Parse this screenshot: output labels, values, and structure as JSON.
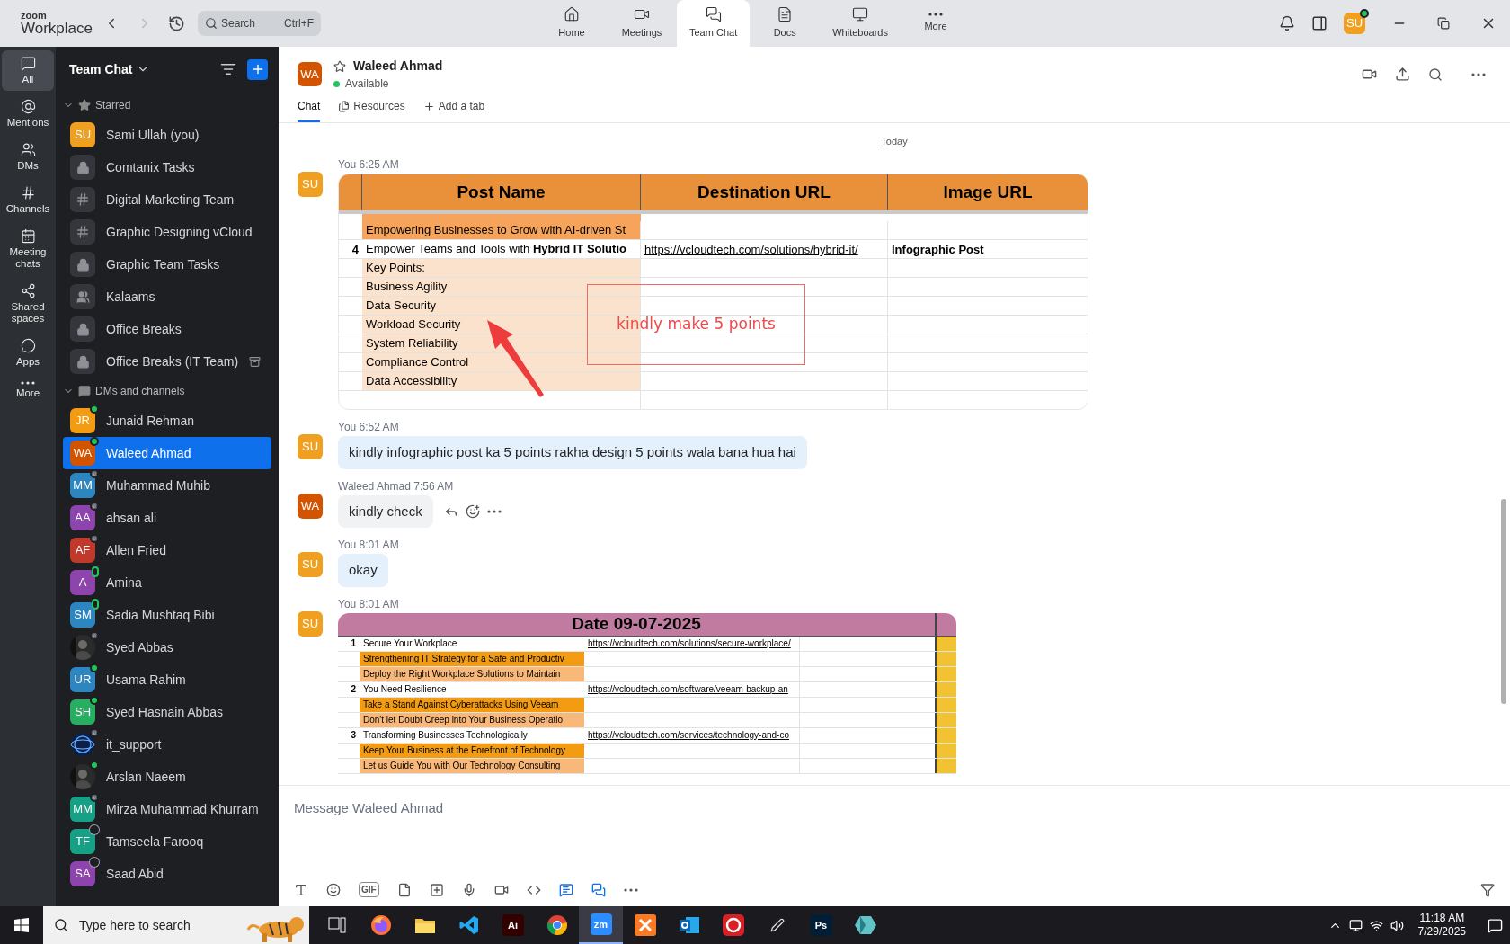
{
  "app": {
    "logo_top": "zoom",
    "logo_bottom": "Workplace"
  },
  "search": {
    "placeholder": "Search",
    "shortcut": "Ctrl+F"
  },
  "nav_tabs": [
    {
      "label": "Home",
      "selected": false
    },
    {
      "label": "Meetings",
      "selected": false
    },
    {
      "label": "Team Chat",
      "selected": true
    },
    {
      "label": "Docs",
      "selected": false
    },
    {
      "label": "Whiteboards",
      "selected": false
    },
    {
      "label": "More",
      "selected": false
    }
  ],
  "user": {
    "initials": "SU",
    "presence": {
      "kind": "online"
    }
  },
  "rail": [
    {
      "label": "All",
      "selected": true
    },
    {
      "label": "Mentions",
      "selected": false
    },
    {
      "label": "DMs",
      "selected": false
    },
    {
      "label": "Channels",
      "selected": false
    },
    {
      "label": "Meeting chats",
      "selected": false
    },
    {
      "label": "Shared spaces",
      "selected": false
    },
    {
      "label": "Apps",
      "selected": false
    },
    {
      "label": "More",
      "selected": false
    }
  ],
  "sidebar": {
    "title": "Team Chat",
    "sections": [
      {
        "title": "Starred",
        "expanded": true,
        "items": [
          {
            "name": "Sami Ullah (you)",
            "kind": "avatar",
            "initials": "SU",
            "color": "#f0a020",
            "archived": false,
            "selected": false
          },
          {
            "name": "Comtanix Tasks",
            "kind": "lock",
            "archived": false,
            "selected": false
          },
          {
            "name": "Digital Marketing Team",
            "kind": "hash",
            "archived": false,
            "selected": false
          },
          {
            "name": "Graphic Designing vCloud",
            "kind": "hash",
            "archived": false,
            "selected": false
          },
          {
            "name": "Graphic Team Tasks",
            "kind": "lock",
            "archived": false,
            "selected": false
          },
          {
            "name": "Kalaams",
            "kind": "group",
            "archived": false,
            "selected": false
          },
          {
            "name": "Office Breaks",
            "kind": "lock",
            "archived": false,
            "selected": false
          },
          {
            "name": "Office Breaks (IT Team)",
            "kind": "lock",
            "archived": true,
            "selected": false
          }
        ]
      },
      {
        "title": "DMs and channels",
        "expanded": true,
        "items": [
          {
            "name": "Junaid Rehman",
            "kind": "avatar",
            "initials": "JR",
            "color": "#f39c12",
            "presence": {
              "kind": "online"
            },
            "archived": false,
            "selected": false
          },
          {
            "name": "Waleed Ahmad",
            "kind": "avatar",
            "initials": "WA",
            "color": "#d35400",
            "presence": {
              "kind": "online"
            },
            "archived": false,
            "selected": true
          },
          {
            "name": "Muhammad Muhib",
            "kind": "avatar",
            "initials": "MM",
            "color": "#2e86c1",
            "presence": {
              "kind": "away"
            },
            "archived": false,
            "selected": false
          },
          {
            "name": "ahsan ali",
            "kind": "avatar",
            "initials": "AA",
            "color": "#8e44ad",
            "presence": {
              "kind": "away"
            },
            "archived": false,
            "selected": false
          },
          {
            "name": "Allen Fried",
            "kind": "avatar",
            "initials": "AF",
            "color": "#c0392b",
            "presence": {
              "kind": "away"
            },
            "archived": false,
            "selected": false
          },
          {
            "name": "Amina",
            "kind": "avatar",
            "initials": "A",
            "color": "#8e44ad",
            "presence": {
              "kind": "mobile"
            },
            "archived": false,
            "selected": false
          },
          {
            "name": "Sadia Mushtaq Bibi",
            "kind": "avatar",
            "initials": "SM",
            "color": "#2e86c1",
            "presence": {
              "kind": "mobile"
            },
            "archived": false,
            "selected": false
          },
          {
            "name": "Syed Abbas",
            "presence": {
              "kind": "away"
            },
            "archived": false,
            "selected": false
          },
          {
            "name": "Usama Rahim",
            "kind": "avatar",
            "initials": "UR",
            "color": "#2e86c1",
            "presence": {
              "kind": "online"
            },
            "archived": false,
            "selected": false
          },
          {
            "name": "Syed Hasnain Abbas",
            "kind": "avatar",
            "initials": "SH",
            "color": "#27ae60",
            "presence": {
              "kind": "online"
            },
            "archived": false,
            "selected": false
          },
          {
            "name": "it_support",
            "kind": "logo",
            "presence": {
              "kind": "away"
            },
            "archived": false,
            "selected": false
          },
          {
            "name": "Arslan Naeem",
            "presence": {
              "kind": "online"
            },
            "archived": false,
            "selected": false
          },
          {
            "name": "Mirza Muhammad Khurram",
            "kind": "avatar",
            "initials": "MM",
            "color": "#16a085",
            "presence": {
              "kind": "away"
            },
            "archived": false,
            "selected": false
          },
          {
            "name": "Tamseela Farooq",
            "kind": "avatar",
            "initials": "TF",
            "color": "#16a085",
            "presence": {
              "kind": "offline"
            },
            "archived": false,
            "selected": false
          },
          {
            "name": "Saad Abid",
            "kind": "avatar",
            "initials": "SA",
            "color": "#8e44ad",
            "presence": {
              "kind": "offline"
            },
            "archived": false,
            "selected": false
          }
        ]
      }
    ]
  },
  "chat": {
    "name": "Waleed Ahmad",
    "initials": "WA",
    "status": "Available",
    "starred": false,
    "tabs": [
      {
        "label": "Chat",
        "selected": true
      },
      {
        "label": "Resources",
        "selected": false
      },
      {
        "label": "Add a tab",
        "selected": false
      }
    ]
  },
  "messages": [
    {
      "kind": "divider",
      "label": "Today"
    },
    {
      "kind": "sheet_posts",
      "sender": "You",
      "time": "6:25 AM",
      "initials": "SU",
      "show_actions": false,
      "headers": [
        "Post Name",
        "Destination URL",
        "Image URL"
      ],
      "rows": [
        {
          "num": "",
          "post": "Empowering Businesses to Grow with AI-driven St",
          "url": "",
          "image": "",
          "color": "#f6a45c"
        },
        {
          "num": "4",
          "post": "Empower Teams and Tools with **Hybrid IT Solutio**",
          "url": "https://vcloudtech.com/solutions/hybrid-it/",
          "image": "Infographic Post",
          "color": "#ffffff"
        },
        {
          "num": "",
          "post": "Key Points:",
          "url": "",
          "image": "",
          "color": "#fbe2cc"
        },
        {
          "num": "",
          "post": "Business Agility",
          "url": "",
          "image": "",
          "color": "#fbe2cc"
        },
        {
          "num": "",
          "post": "Data Security",
          "url": "",
          "image": "",
          "color": "#fbe2cc"
        },
        {
          "num": "",
          "post": "Workload Security",
          "url": "",
          "image": "",
          "color": "#fbe2cc"
        },
        {
          "num": "",
          "post": "System Reliability",
          "url": "",
          "image": "",
          "color": "#fbe2cc"
        },
        {
          "num": "",
          "post": "Compliance Control",
          "url": "",
          "image": "",
          "color": "#fbe2cc"
        },
        {
          "num": "",
          "post": "Data Accessibility",
          "url": "",
          "image": "",
          "color": "#fbe2cc"
        }
      ],
      "note": "kindly make 5 points"
    },
    {
      "kind": "text",
      "sender": "You",
      "time": "6:52 AM",
      "initials": "SU",
      "show_actions": false,
      "text": "kindly infographic post ka 5 points rakha design 5 points wala bana hua hai"
    },
    {
      "kind": "text",
      "sender": "Waleed Ahmad",
      "time": "7:56 AM",
      "initials": "WA",
      "show_actions": true,
      "text": "kindly check"
    },
    {
      "kind": "text",
      "sender": "You",
      "time": "8:01 AM",
      "initials": "SU",
      "show_actions": false,
      "text": "okay"
    },
    {
      "kind": "sheet_dated",
      "sender": "You",
      "time": "8:01 AM",
      "initials": "SU",
      "show_actions": false,
      "title": "Date 09-07-2025",
      "rows": [
        {
          "num": "1",
          "post": "Secure Your Workplace",
          "url": "https://vcloudtech.com/solutions/secure-workplace/",
          "color": "#ffffff"
        },
        {
          "num": "",
          "post": "Strengthening IT Strategy for a Safe and Productiv",
          "url": "",
          "color": "#f39c12"
        },
        {
          "num": "",
          "post": "Deploy the Right Workplace Solutions to Maintain",
          "url": "",
          "color": "#f8b87a"
        },
        {
          "num": "2",
          "post": "You Need Resilience",
          "url": "https://vcloudtech.com/software/veeam-backup-an",
          "color": "#ffffff"
        },
        {
          "num": "",
          "post": "Take a Stand Against Cyberattacks Using Veeam",
          "url": "",
          "color": "#f39c12"
        },
        {
          "num": "",
          "post": "Don't let Doubt Creep into Your Business Operatio",
          "url": "",
          "color": "#f8b87a"
        },
        {
          "num": "3",
          "post": "Transforming Businesses Technologically",
          "url": "https://vcloudtech.com/services/technology-and-co",
          "color": "#ffffff"
        },
        {
          "num": "",
          "post": "Keep Your Business at the Forefront of Technology",
          "url": "",
          "color": "#f39c12"
        },
        {
          "num": "",
          "post": "Let us Guide You with Our Technology Consulting",
          "url": "",
          "color": "#f8b87a"
        }
      ]
    }
  ],
  "composer": {
    "placeholder": "Message Waleed Ahmad",
    "gif_label": "GIF"
  },
  "taskbar": {
    "search_placeholder": "Type here to search",
    "time": "11:18 AM",
    "date": "7/29/2025",
    "apps": [
      {
        "kind": "taskview",
        "selected": false
      },
      {
        "kind": "firefox",
        "selected": false
      },
      {
        "kind": "files",
        "selected": false
      },
      {
        "kind": "vscode",
        "selected": false
      },
      {
        "kind": "tile",
        "label": "Ai",
        "color": "#330000",
        "selected": false
      },
      {
        "kind": "chrome",
        "selected": false
      },
      {
        "kind": "tile",
        "label": "zm",
        "color": "#2d8cff",
        "selected": true
      },
      {
        "kind": "xampp",
        "selected": false
      },
      {
        "kind": "outlook",
        "selected": false
      },
      {
        "kind": "cloud",
        "selected": false
      },
      {
        "kind": "pen",
        "selected": false
      },
      {
        "kind": "tile",
        "label": "Ps",
        "color": "#001e36",
        "selected": false
      },
      {
        "kind": "gem",
        "selected": false
      }
    ]
  }
}
